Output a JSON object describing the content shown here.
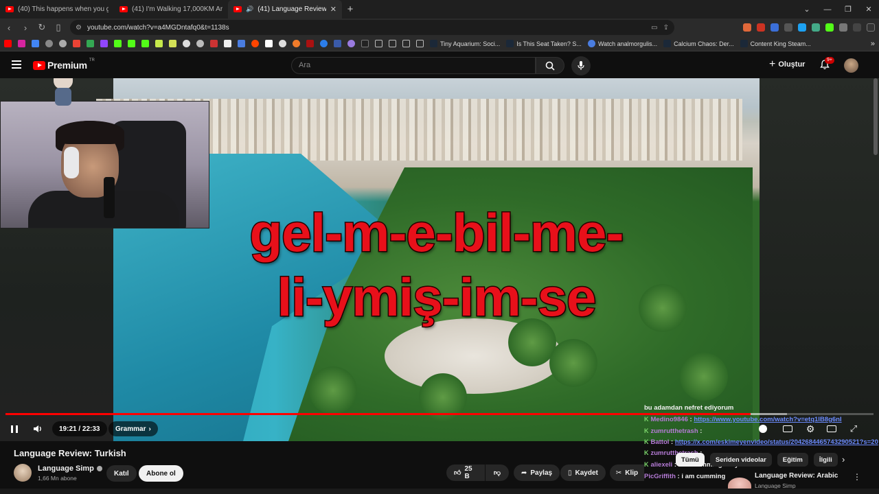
{
  "browser": {
    "tabs": [
      {
        "label": "(40) This happens when you get clos",
        "active": false
      },
      {
        "label": "(41) I'm Walking 17,000KM Around th",
        "active": false
      },
      {
        "label": "(41) Language Review: Turkish",
        "active": true
      }
    ],
    "url": "youtube.com/watch?v=a4MGDntafq0&t=1138s",
    "bookmarks": [
      "Tiny Aquarium: Soci...",
      "Is This Seat Taken? S...",
      "Watch analmorgulis...",
      "Calcium Chaos: Der...",
      "Content King Steam..."
    ],
    "bookmark_more": "»"
  },
  "youtube": {
    "logo_text": "Premium",
    "logo_region": "TR",
    "search_placeholder": "Ara",
    "create_label": "Oluştur",
    "notif_badge": "9+"
  },
  "video": {
    "overlay_line1": "gel-m-e-bil-me-",
    "overlay_line2": "li-ymiş-im-se",
    "time": "19:21 / 22:33",
    "chapter": "Grammar",
    "progress": 0.858,
    "buffered": 0.9
  },
  "chat": [
    {
      "user": "",
      "text": "bu adamdan nefret ediyorum",
      "link": false
    },
    {
      "user": "Medino9846",
      "text": "https://www.youtube.com/watch?v=etq1lB8g6nI",
      "link": true
    },
    {
      "user": "zumrutthetrash",
      "text": "",
      "link": false
    },
    {
      "user": "Battol",
      "text": "https://x.com/eskimeyenvideo/status/2042684465743290521?s=20",
      "link": true
    },
    {
      "user": "zumrutthetrash",
      "text": "",
      "link": false
    },
    {
      "user": "aliexeli",
      "text": "i am cumming ow yes",
      "link": false
    },
    {
      "user": "PicGriffith",
      "text": "i am cumming",
      "link": false
    }
  ],
  "below": {
    "title": "Language Review: Turkish",
    "channel": "Language Simp",
    "subs": "1,66 Mn abone",
    "join_label": "Katıl",
    "subscribe_label": "Abone ol",
    "likes": "25 B",
    "share_label": "Paylaş",
    "save_label": "Kaydet",
    "clip_label": "Klip"
  },
  "chips": [
    "Tümü",
    "Seriden videolar",
    "Eğitim",
    "İlgili"
  ],
  "recommended": {
    "title": "Language Review: Arabic",
    "channel": "Language Simp"
  }
}
